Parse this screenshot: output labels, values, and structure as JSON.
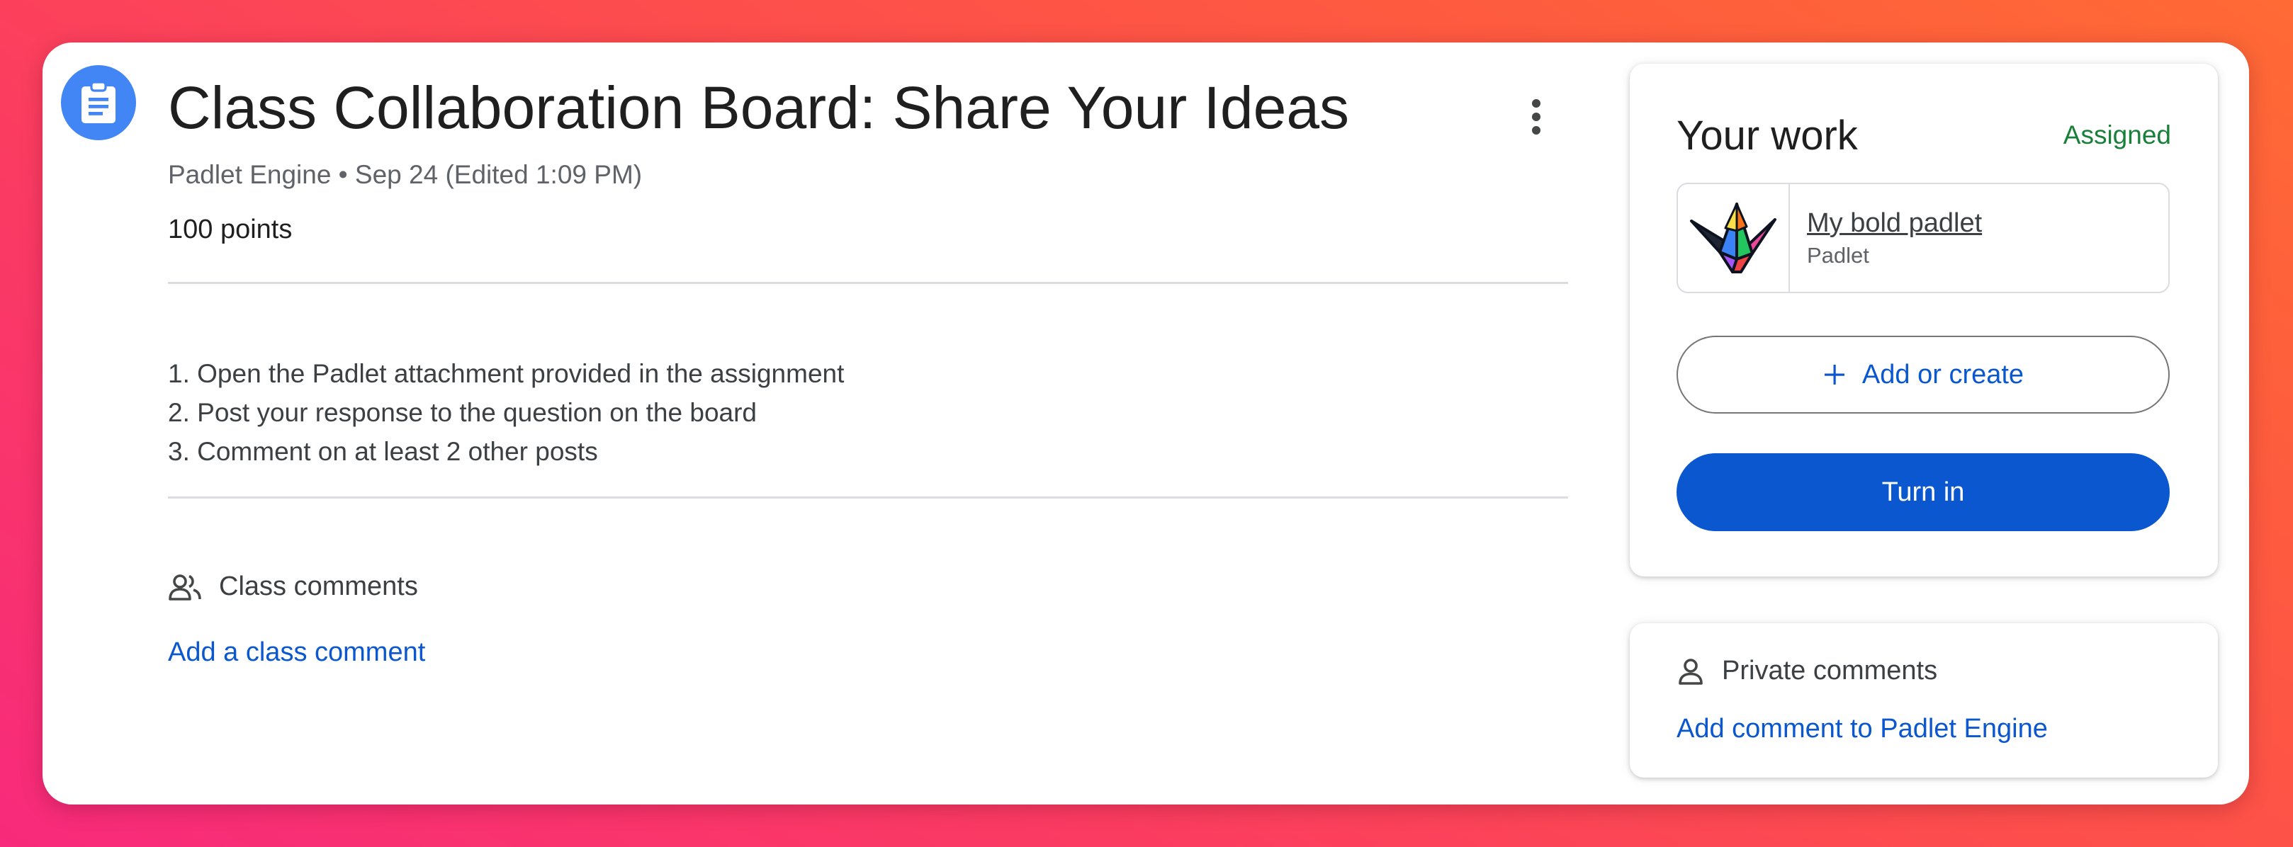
{
  "assignment": {
    "icon": "assignment-clipboard-icon",
    "title": "Class Collaboration Board: Share Your Ideas",
    "meta": "Padlet Engine • Sep 24 (Edited 1:09 PM)",
    "points": "100 points",
    "more_icon": "more-vert-icon",
    "instructions": [
      "1. Open the Padlet attachment provided in the assignment",
      "2. Post your response to the question on the board",
      "3. Comment on at least 2 other posts"
    ]
  },
  "class_comments": {
    "icon": "people-icon",
    "label": "Class comments",
    "add_link": "Add a class comment"
  },
  "your_work": {
    "title": "Your work",
    "status": "Assigned",
    "status_color": "#188038",
    "attachment": {
      "icon": "padlet-logo-icon",
      "name": "My bold padlet",
      "type": "Padlet"
    },
    "add_or_create": {
      "icon": "plus-icon",
      "label": "Add or create"
    },
    "turn_in_label": "Turn in",
    "accent_color": "#0b57d0"
  },
  "private_comments": {
    "icon": "person-icon",
    "label": "Private comments",
    "add_link": "Add comment to Padlet Engine"
  }
}
